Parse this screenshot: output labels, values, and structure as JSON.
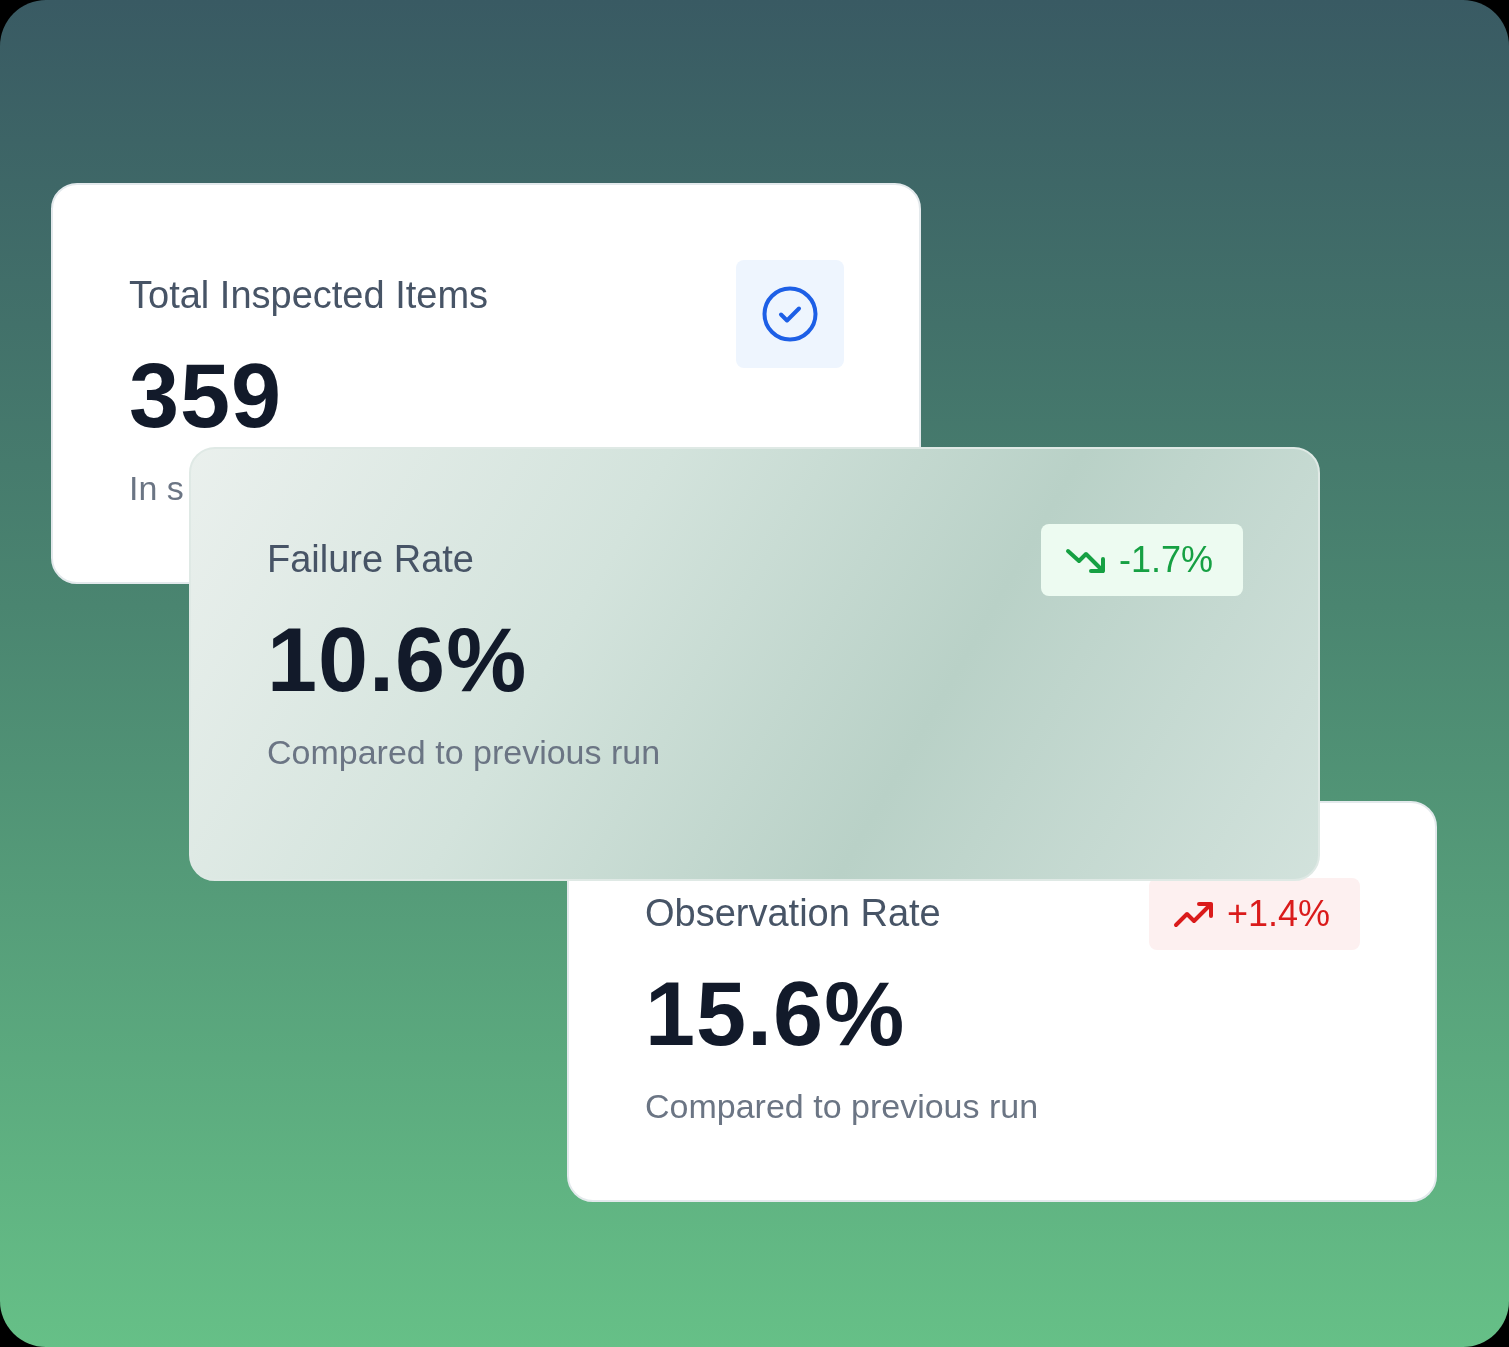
{
  "cards": [
    {
      "kind": "plain",
      "title": "Total Inspected Items",
      "value": "359",
      "subtitle": "In s",
      "badge": {
        "kind": "check"
      }
    },
    {
      "kind": "frosted",
      "title": "Failure Rate",
      "value": "10.6%",
      "subtitle": "Compared to previous run",
      "badge": {
        "kind": "down",
        "text": "-1.7%"
      }
    },
    {
      "kind": "plain",
      "title": "Observation Rate",
      "value": "15.6%",
      "subtitle": "Compared to previous run",
      "badge": {
        "kind": "up",
        "text": "+1.4%"
      }
    }
  ]
}
